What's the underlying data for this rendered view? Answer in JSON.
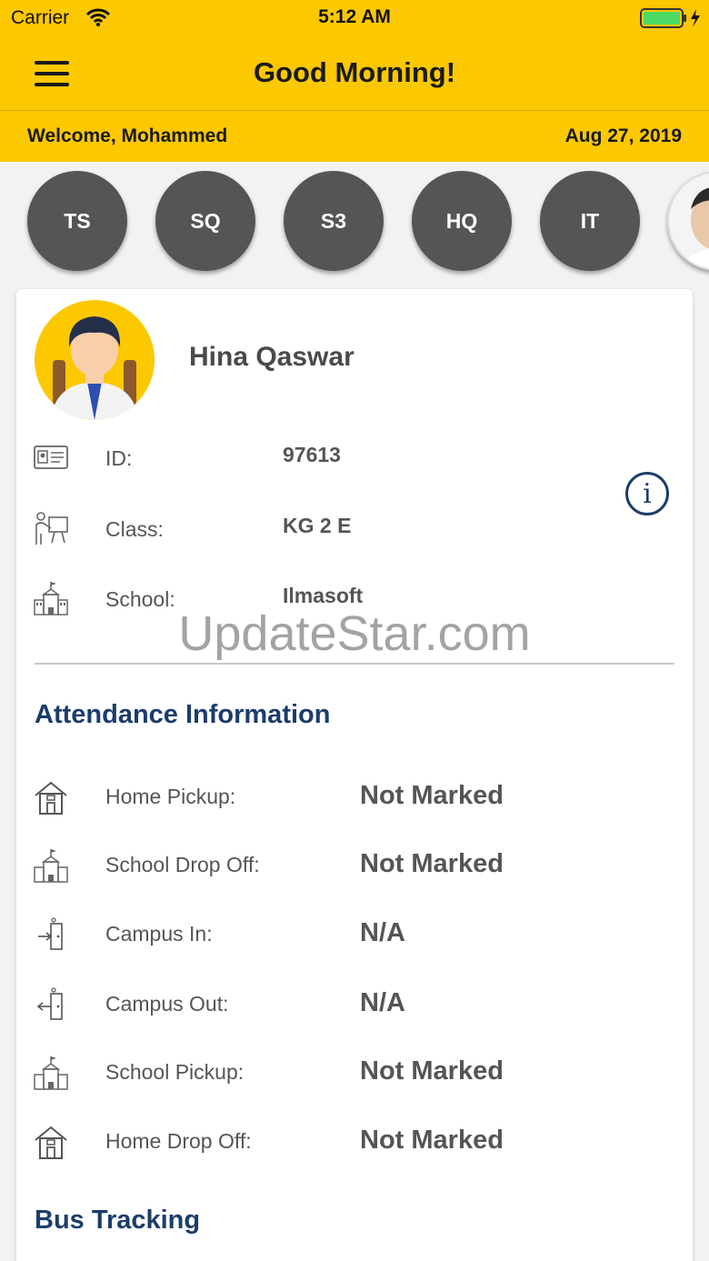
{
  "status_bar": {
    "carrier": "Carrier",
    "time": "5:12 AM"
  },
  "nav": {
    "title": "Good Morning!"
  },
  "welcome": {
    "text": "Welcome, Mohammed",
    "date": "Aug 27, 2019"
  },
  "avatars": [
    "TS",
    "SQ",
    "S3",
    "HQ",
    "IT"
  ],
  "student": {
    "name": "Hina Qaswar",
    "id_label": "ID:",
    "id_value": "97613",
    "class_label": "Class:",
    "class_value": "KG 2 E",
    "school_label": "School:",
    "school_value": "Ilmasoft"
  },
  "watermark": "UpdateStar.com",
  "attendance": {
    "title": "Attendance Information",
    "rows": [
      {
        "label": "Home Pickup:",
        "value": "Not Marked",
        "icon": "house-icon"
      },
      {
        "label": "School Drop Off:",
        "value": "Not Marked",
        "icon": "school-building-icon"
      },
      {
        "label": "Campus In:",
        "value": "N/A",
        "icon": "door-enter-icon"
      },
      {
        "label": "Campus Out:",
        "value": "N/A",
        "icon": "door-exit-icon"
      },
      {
        "label": "School Pickup:",
        "value": "Not Marked",
        "icon": "school-building-icon"
      },
      {
        "label": "Home Drop Off:",
        "value": "Not Marked",
        "icon": "house-icon"
      }
    ]
  },
  "bus_tracking": {
    "title": "Bus Tracking"
  },
  "colors": {
    "brand_yellow": "#fcc800",
    "heading_blue": "#1c3d6b",
    "avatar_gray": "#555556"
  }
}
